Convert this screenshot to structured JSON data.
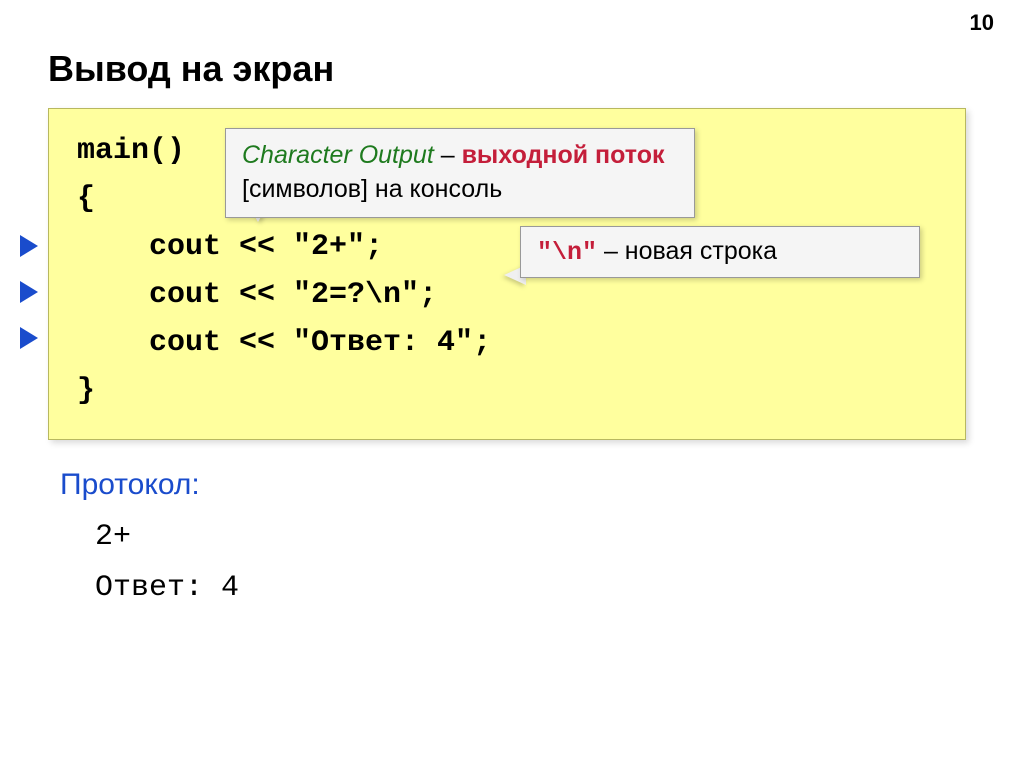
{
  "pageNumber": "10",
  "title": "Вывод на экран",
  "code": {
    "line1": "main()",
    "line2": "{",
    "line3": "    cout << \"2+\";",
    "line4": "    cout << \"2=?\\n\";",
    "line5": "    cout << \"Ответ: 4\";",
    "line6": "}"
  },
  "callout1": {
    "italic": "Character Output",
    "dash": " – ",
    "boldRed": "выходной поток",
    "rest": " [символов] на консоль"
  },
  "callout2": {
    "mono": "\"\\n\"",
    "rest": " – новая строка"
  },
  "protocolLabel": "Протокол:",
  "output": {
    "line1": "2+",
    "line2": "Ответ: 4"
  }
}
